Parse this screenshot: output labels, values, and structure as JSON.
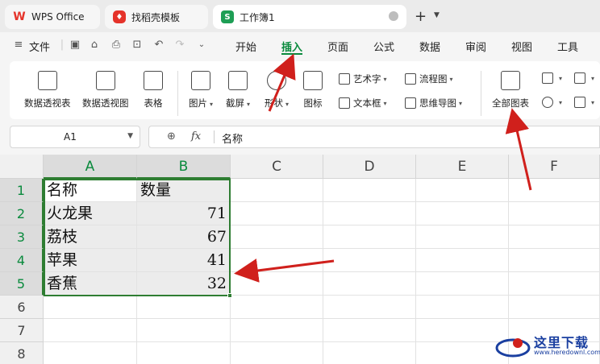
{
  "tabs": [
    {
      "label": "WPS Office",
      "icon": "wps-logo-icon"
    },
    {
      "label": "找稻壳模板",
      "icon": "docer-icon"
    },
    {
      "label": "工作簿1",
      "icon": "spreadsheet-s-icon",
      "badge": "S"
    }
  ],
  "menubar": {
    "file_label": "文件",
    "items": [
      "开始",
      "插入",
      "页面",
      "公式",
      "数据",
      "审阅",
      "视图",
      "工具"
    ],
    "active": "插入"
  },
  "ribbon": {
    "pivot_table": "数据透视表",
    "pivot_chart": "数据透视图",
    "table": "表格",
    "picture": "图片",
    "screenshot": "截屏",
    "shape": "形状",
    "icon": "图标",
    "wordart": "艺术字",
    "textbox": "文本框",
    "flowchart": "流程图",
    "mindmap": "思维导图",
    "all_charts": "全部图表"
  },
  "formula_bar": {
    "cell_ref": "A1",
    "fx_label": "fx",
    "value": "名称"
  },
  "grid": {
    "columns": [
      "A",
      "B",
      "C",
      "D",
      "E",
      "F"
    ],
    "rows": [
      "1",
      "2",
      "3",
      "4",
      "5",
      "6",
      "7",
      "8"
    ],
    "data": [
      [
        "名称",
        "数量"
      ],
      [
        "火龙果",
        "71"
      ],
      [
        "荔枝",
        "67"
      ],
      [
        "苹果",
        "41"
      ],
      [
        "香蕉",
        "32"
      ]
    ]
  },
  "watermark": {
    "text": "这里下载",
    "url": "www.heredownl.com"
  },
  "colors": {
    "accent_green": "#0a8a3d",
    "selection_border": "#2e7d32",
    "arrow_red": "#d0201c"
  }
}
